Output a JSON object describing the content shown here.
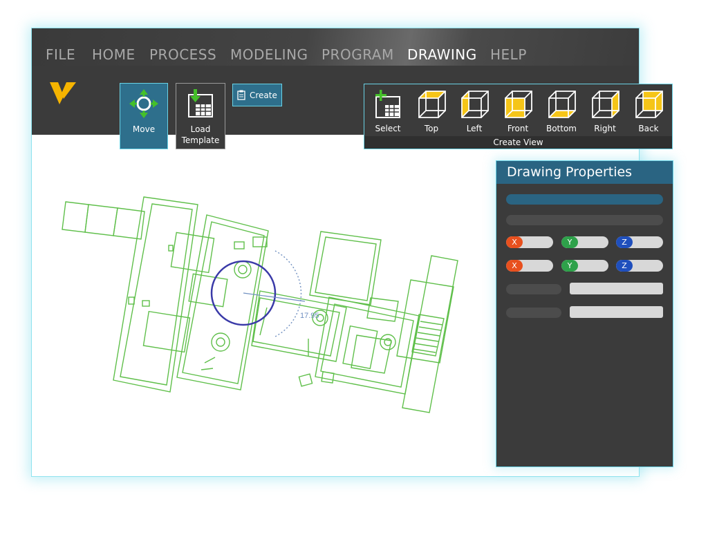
{
  "menu": {
    "items": [
      "FILE",
      "HOME",
      "PROCESS",
      "MODELING",
      "PROGRAM",
      "DRAWING",
      "HELP"
    ],
    "active": "DRAWING"
  },
  "ribbon": {
    "move_label": "Move",
    "load_template_label_1": "Load",
    "load_template_label_2": "Template",
    "create_label": "Create"
  },
  "create_view": {
    "group_label": "Create View",
    "buttons": [
      "Select",
      "Top",
      "Left",
      "Front",
      "Bottom",
      "Right",
      "Back"
    ]
  },
  "drawing": {
    "dimension_value": "17.95"
  },
  "properties": {
    "title": "Drawing Properties",
    "axis_labels": [
      "X",
      "Y",
      "Z"
    ]
  },
  "colors": {
    "accent": "#2a6482",
    "highlight": "#6ad3e6",
    "face": "#f5c518",
    "drawing_lines": "#5fbf4a",
    "gizmo": "#3a3aa8",
    "axis_x": "#e8501e",
    "axis_y": "#2ea14a",
    "axis_z": "#1f4fbd"
  },
  "icons": {
    "logo": "v-logo-icon",
    "move": "move-arrows-icon",
    "load_template": "load-template-icon",
    "create": "clipboard-icon",
    "select": "select-view-icon",
    "views": [
      "cube-top-icon",
      "cube-left-icon",
      "cube-front-icon",
      "cube-bottom-icon",
      "cube-right-icon",
      "cube-back-icon"
    ]
  }
}
